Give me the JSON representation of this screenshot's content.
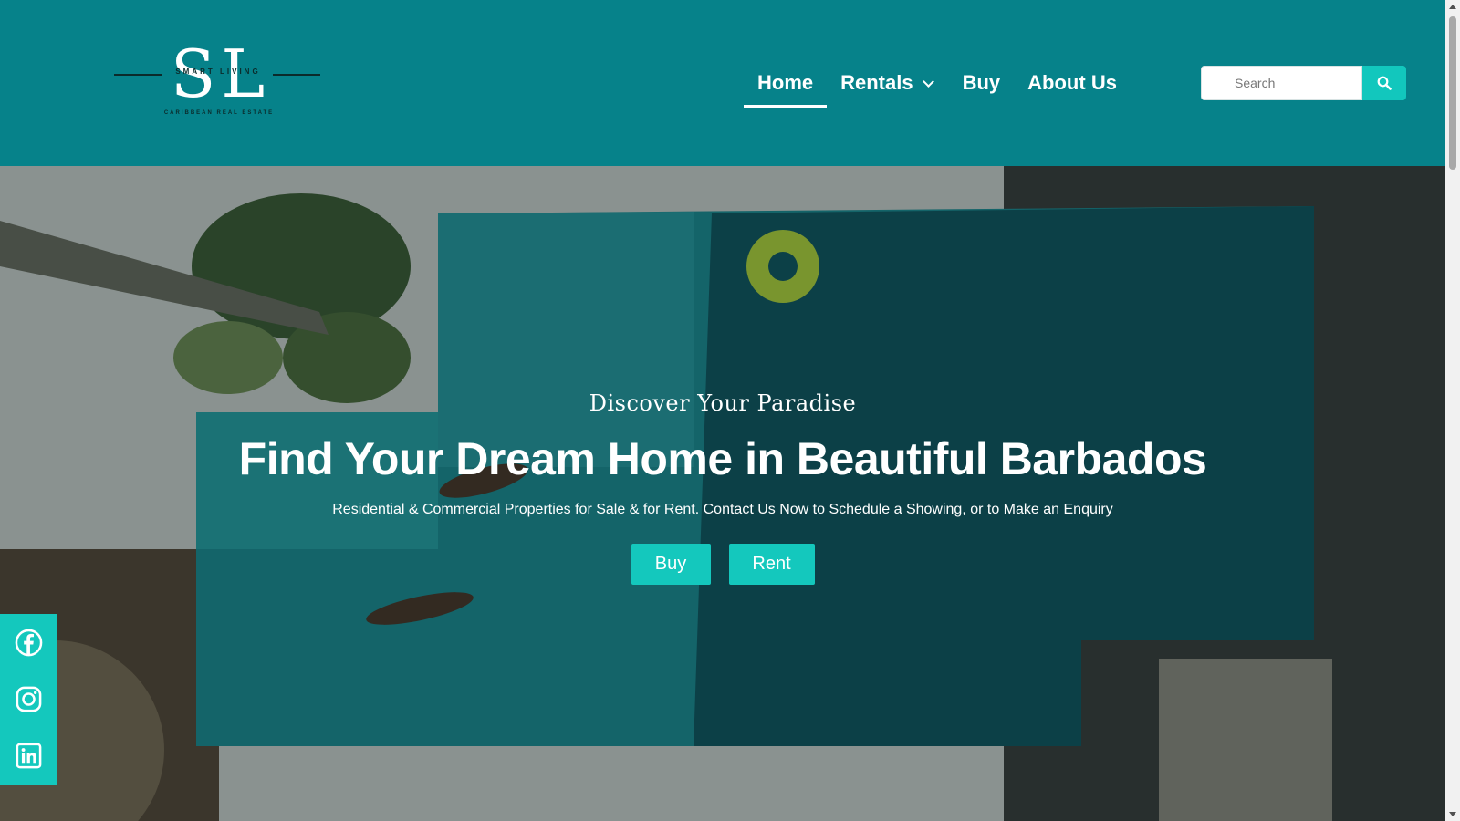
{
  "header": {
    "background": "#06828a",
    "logo": {
      "letters": "SL",
      "tagline_top": "SMART LIVING",
      "tagline_bottom": "CARIBBEAN REAL ESTATE"
    },
    "nav": [
      {
        "label": "Home",
        "active": true
      },
      {
        "label": "Rentals",
        "has_dropdown": true
      },
      {
        "label": "Buy"
      },
      {
        "label": "About Us"
      }
    ],
    "search": {
      "placeholder": "Search",
      "button_icon": "search-icon"
    }
  },
  "hero": {
    "subtitle": "Discover Your Paradise",
    "title": "Find Your Dream Home in Beautiful Barbados",
    "description": "Residential & Commercial Properties for Sale & for Rent. Contact Us Now to Schedule a Showing, or to Make an Enquiry",
    "buttons": {
      "buy": "Buy",
      "rent": "Rent"
    },
    "button_color": "#14c8bd"
  },
  "social": {
    "background": "#14c8bd",
    "icons": [
      "facebook-icon",
      "instagram-icon",
      "linkedin-icon"
    ]
  }
}
